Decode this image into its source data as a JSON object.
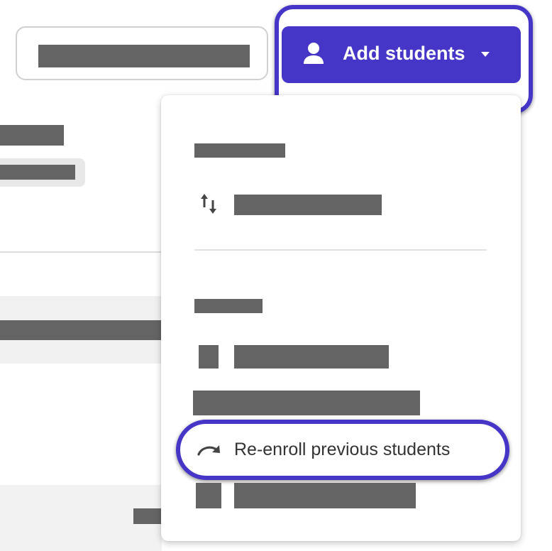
{
  "search": {
    "placeholder": "",
    "value": ""
  },
  "toolbar": {
    "add_students_label": "Add students",
    "add_students_icon": "person-icon",
    "add_students_caret": "caret-down-icon",
    "accent_color": "#4536c8"
  },
  "menu": {
    "sections": [
      {
        "heading": "",
        "items": [
          {
            "icon": "swap-vertical-icon",
            "label": ""
          }
        ]
      },
      {
        "heading": "",
        "items": [
          {
            "icon": "",
            "label": ""
          },
          {
            "icon": "",
            "label": ""
          },
          {
            "icon": "redo-arrow-icon",
            "label": "Re-enroll previous students",
            "highlighted": true
          },
          {
            "icon": "",
            "label": ""
          }
        ]
      }
    ]
  },
  "colors": {
    "redaction": "#646464",
    "highlight": "#4536c8",
    "panel_background": "#f0f0f0"
  }
}
